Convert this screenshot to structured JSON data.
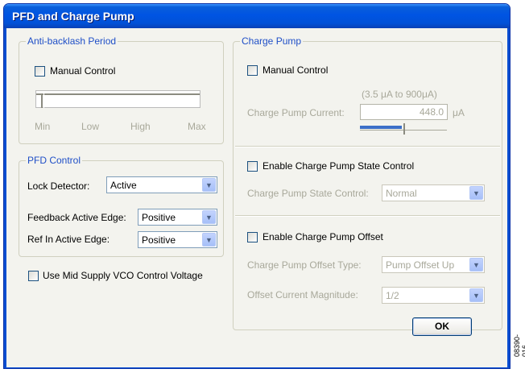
{
  "window": {
    "title": "PFD and Charge Pump"
  },
  "anti_backlash": {
    "title": "Anti-backlash Period",
    "manual_label": "Manual Control",
    "ticks": [
      "Min",
      "Low",
      "High",
      "Max"
    ]
  },
  "pfd": {
    "title": "PFD Control",
    "lock_label": "Lock Detector:",
    "lock_value": "Active",
    "feedback_label": "Feedback Active Edge:",
    "feedback_value": "Positive",
    "refin_label": "Ref In Active Edge:",
    "refin_value": "Positive"
  },
  "mid_supply_label": "Use Mid Supply VCO Control Voltage",
  "charge_pump": {
    "title": "Charge Pump",
    "manual_label": "Manual Control",
    "range_label": "(3.5 μA to 900μA)",
    "current_label": "Charge Pump Current:",
    "current_value": "448.0",
    "current_unit": "μA",
    "state_enable_label": "Enable Charge Pump State Control",
    "state_label": "Charge Pump State Control:",
    "state_value": "Normal",
    "offset_enable_label": "Enable Charge Pump Offset",
    "offset_type_label": "Charge Pump Offset Type:",
    "offset_type_value": "Pump Offset Up",
    "offset_mag_label": "Offset Current Magnitude:",
    "offset_mag_value": "1/2"
  },
  "ok_label": "OK",
  "figure_code": "08390-016"
}
